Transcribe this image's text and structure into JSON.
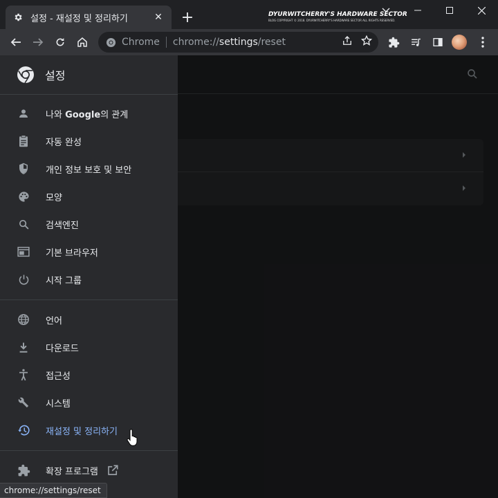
{
  "tab": {
    "title": "설정 - 재설정 및 정리하기",
    "close_glyph": "✕",
    "icon": "gear-icon"
  },
  "newtab_glyph": "+",
  "watermark": {
    "title": "DYURWITCHERRY'S HARDWARE SECTOR",
    "subtitle": "BLOG COPYRIGHT © 2018. DYURWITCHERRY'S HARDWARE SECTOR ALL RIGHTS RESERVED."
  },
  "omnibox": {
    "chip": "Chrome",
    "url_scheme": "chrome://",
    "url_host": "settings",
    "url_path": "/reset"
  },
  "drawer": {
    "title": "설정",
    "items": [
      {
        "label_pre": "나와 ",
        "label_bold": "Google",
        "label_post": "의 관계",
        "icon": "person-icon"
      },
      {
        "label": "자동 완성",
        "icon": "clipboard-icon"
      },
      {
        "label": "개인 정보 보호 및 보안",
        "icon": "shield-icon"
      },
      {
        "label": "모양",
        "icon": "palette-icon"
      },
      {
        "label": "검색엔진",
        "icon": "search-icon"
      },
      {
        "label": "기본 브라우저",
        "icon": "browser-icon"
      },
      {
        "label": "시작 그룹",
        "icon": "power-icon"
      }
    ],
    "advanced": [
      {
        "label": "언어",
        "icon": "globe-icon"
      },
      {
        "label": "다운로드",
        "icon": "download-icon"
      },
      {
        "label": "접근성",
        "icon": "accessibility-icon"
      },
      {
        "label": "시스템",
        "icon": "wrench-icon"
      },
      {
        "label": "재설정 및 정리하기",
        "icon": "restore-icon",
        "active": true
      }
    ],
    "extensions": {
      "label": "확장 프로그램",
      "icon": "puzzle-icon"
    }
  },
  "status_url": "chrome://settings/reset",
  "colors": {
    "accent": "#8ab4f8",
    "background": "#202124",
    "drawer": "#292a2d",
    "toolbar": "#35363a"
  }
}
